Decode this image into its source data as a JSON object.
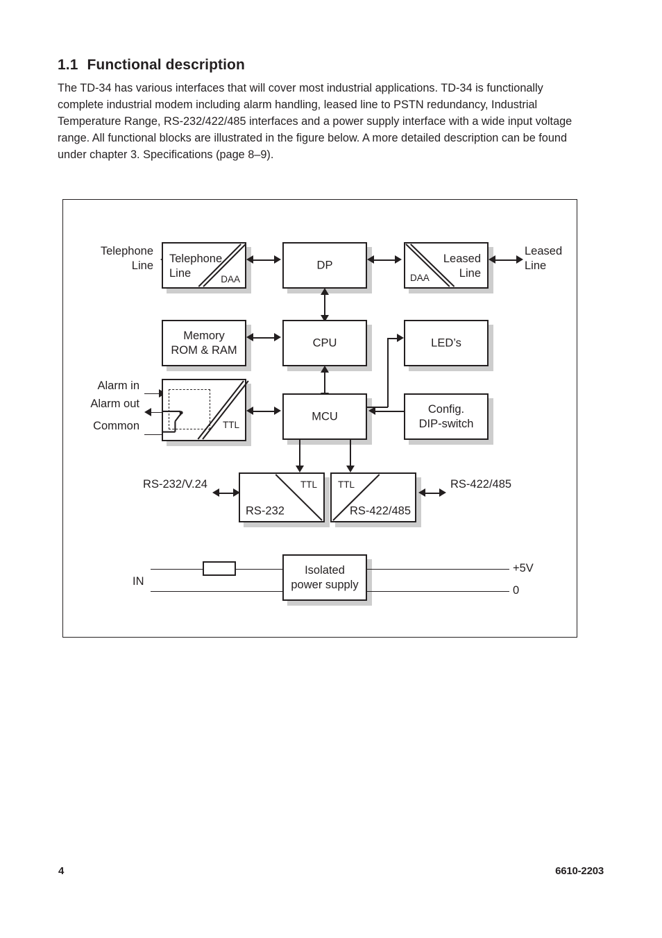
{
  "heading": {
    "number": "1.1",
    "title": "Functional description"
  },
  "intro": {
    "text": "The TD-34 has various interfaces that will cover most industrial applications. TD-34 is functionally complete industrial modem including alarm handling, leased line to PSTN redundancy, Industrial Temperature Range, RS-232/422/485 interfaces and a power supply interface with a wide input voltage range. All functional blocks are illustrated in the figure below. A more detailed description can be found under chapter 3. Specifications (page 8–9)."
  },
  "diagram": {
    "blocks": {
      "telephone_line": {
        "label": "Telephone\nLine",
        "tag": "DAA"
      },
      "dp": {
        "label": "DP"
      },
      "leased_line": {
        "label": "Leased\nLine",
        "tag": "DAA"
      },
      "memory": {
        "label": "Memory\nROM & RAM"
      },
      "cpu": {
        "label": "CPU"
      },
      "leds": {
        "label": "LED’s"
      },
      "alarm": {
        "tag": "TTL"
      },
      "mcu": {
        "label": "MCU"
      },
      "dip_switch": {
        "label": "Config.\nDIP-switch"
      },
      "rs232": {
        "label": "RS-232",
        "tag": "TTL"
      },
      "rs422": {
        "label": "RS-422/485",
        "tag": "TTL"
      },
      "power_supply": {
        "label": "Isolated\npower supply"
      }
    },
    "external_labels": {
      "telephone_line_in": "Telephone\nLine",
      "leased_line_out": "Leased\nLine",
      "alarm_in": "Alarm in",
      "alarm_out": "Alarm out",
      "common": "Common",
      "rs232_port": "RS-232/V.24",
      "rs422_port": "RS-422/485",
      "power_in": "IN",
      "power_plus5v": "+5V",
      "power_zero": "0"
    }
  },
  "footer": {
    "page_number": "4",
    "document_code": "6610-2203"
  },
  "colors": {
    "ink": "#231f20",
    "shadow": "#cdcdcd",
    "page": "#ffffff"
  }
}
